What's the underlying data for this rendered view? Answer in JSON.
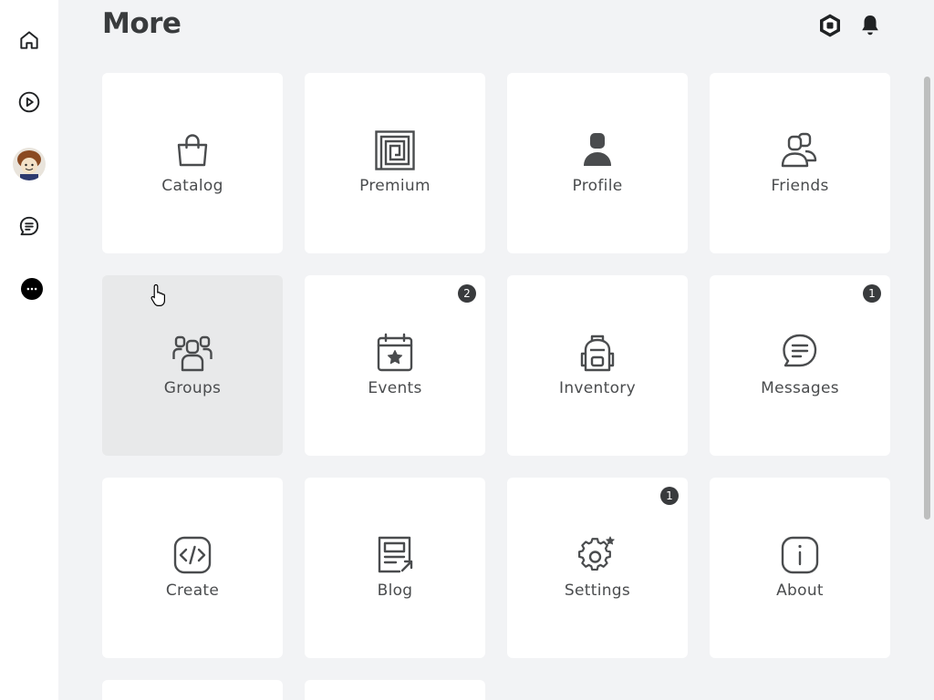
{
  "page": {
    "title": "More"
  },
  "sidebar": {
    "items": [
      {
        "name": "home",
        "icon": "home-icon"
      },
      {
        "name": "discover",
        "icon": "play-icon"
      },
      {
        "name": "profile",
        "icon": "avatar"
      },
      {
        "name": "chat",
        "icon": "chat-icon"
      },
      {
        "name": "more",
        "icon": "more-icon"
      }
    ]
  },
  "header": {
    "icons": [
      "robux-icon",
      "bell-icon"
    ]
  },
  "tiles": [
    {
      "label": "Catalog",
      "icon": "shopping-bag-icon",
      "badge": ""
    },
    {
      "label": "Premium",
      "icon": "premium-icon",
      "badge": ""
    },
    {
      "label": "Profile",
      "icon": "person-icon",
      "badge": ""
    },
    {
      "label": "Friends",
      "icon": "friends-icon",
      "badge": ""
    },
    {
      "label": "Groups",
      "icon": "groups-icon",
      "badge": ""
    },
    {
      "label": "Events",
      "icon": "calendar-star-icon",
      "badge": "2"
    },
    {
      "label": "Inventory",
      "icon": "backpack-icon",
      "badge": ""
    },
    {
      "label": "Messages",
      "icon": "message-icon",
      "badge": "1"
    },
    {
      "label": "Create",
      "icon": "code-icon",
      "badge": ""
    },
    {
      "label": "Blog",
      "icon": "blog-icon",
      "badge": ""
    },
    {
      "label": "Settings",
      "icon": "gear-icon",
      "badge": "1"
    },
    {
      "label": "About",
      "icon": "info-icon",
      "badge": ""
    }
  ],
  "colors": {
    "background": "#f2f3f5",
    "tile": "#ffffff",
    "tile_hover": "#e8e9ea",
    "text": "#393b3d",
    "badge": "#393b3d"
  }
}
